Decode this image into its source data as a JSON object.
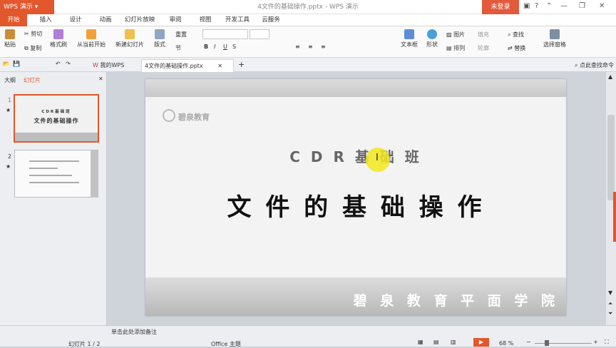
{
  "app": {
    "name": "WPS 演示",
    "doc_title": "4文件的基础操作.pptx - WPS 演示",
    "login": "未登录"
  },
  "menu": [
    "开始",
    "插入",
    "设计",
    "动画",
    "幻灯片放映",
    "审阅",
    "视图",
    "开发工具",
    "云服务"
  ],
  "ribbon": {
    "paste": "粘贴",
    "cut": "剪切",
    "copy": "复制",
    "format_painter": "格式刷",
    "from_current": "从当前开始",
    "new_slide": "新建幻灯片",
    "layout": "版式",
    "reset": "重置",
    "section": "节",
    "textbox": "文本框",
    "shape": "形状",
    "picture": "图片",
    "fill": "填充",
    "arrange": "排列",
    "outline": "轮廓",
    "find": "查找",
    "replace": "替换",
    "select_pane": "选择窗格"
  },
  "tabs": {
    "mywps": "我的WPS",
    "doc": "4文件的基础操作.pptx",
    "command_search": "点此查找命令"
  },
  "panel": {
    "outline": "大纲",
    "slides": "幻灯片"
  },
  "thumbs": [
    {
      "num": "1",
      "line1": "CDR基础班",
      "line2": "文件的基础操作"
    },
    {
      "num": "2"
    }
  ],
  "slide": {
    "logo_text": "碧泉教育",
    "subtitle": "C D R 基 础 班",
    "title": "文 件 的 基 础 操 作",
    "footer": "碧 泉 教 育 平 面 学 院"
  },
  "status": {
    "notes": "单击此处添加备注",
    "slide_count": "幻灯片 1 / 2",
    "theme": "Office 主题",
    "zoom": "68 %"
  },
  "colors": {
    "accent": "#e2572b"
  }
}
